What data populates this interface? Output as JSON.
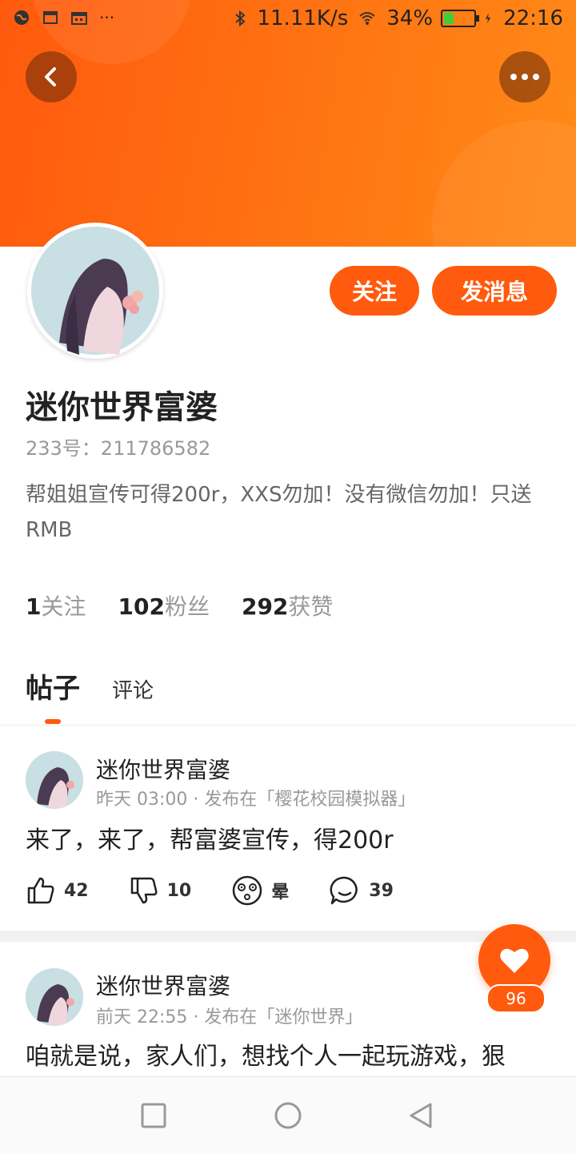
{
  "status_bar": {
    "network_speed": "11.11K/s",
    "battery": "34%",
    "time": "22:16",
    "more": "···"
  },
  "profile": {
    "name": "迷你世界富婆",
    "id_line": "233号：211786582",
    "bio": "帮姐姐宣传可得200r，XXS勿加！没有微信勿加！只送RMB",
    "follow_label": "关注",
    "message_label": "发消息",
    "stats": [
      {
        "num": "1",
        "label": "关注"
      },
      {
        "num": "102",
        "label": "粉丝"
      },
      {
        "num": "292",
        "label": "获赞"
      }
    ]
  },
  "tabs": {
    "posts": "帖子",
    "comments": "评论"
  },
  "posts": [
    {
      "author": "迷你世界富婆",
      "meta": "昨天 03:00 · 发布在「樱花校园模拟器」",
      "text": "来了，来了，帮富婆宣传，得200r",
      "likes": "42",
      "dislikes": "10",
      "dizzy": "晕",
      "comments": "39"
    },
    {
      "author": "迷你世界富婆",
      "meta": "前天 22:55 · 发布在「迷你世界」",
      "text": "咱就是说，家人们，想找个人一起玩游戏，狠"
    }
  ],
  "fab": {
    "count": "96"
  },
  "colors": {
    "accent": "#ff5a0e"
  }
}
